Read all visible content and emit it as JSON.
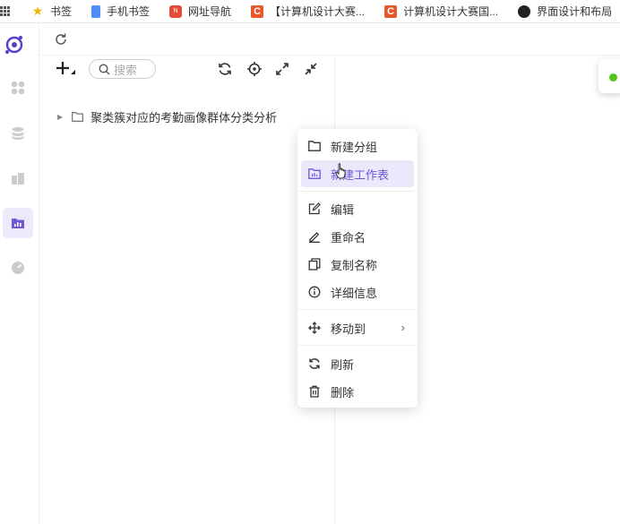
{
  "bookmarks": [
    {
      "label": "书签",
      "icon": "star-icon"
    },
    {
      "label": "手机书签",
      "icon": "phone-bookmark-icon"
    },
    {
      "label": "网址导航",
      "icon": "nav-icon"
    },
    {
      "label": "【计算机设计大赛...",
      "icon": "c-site-icon"
    },
    {
      "label": "计算机设计大赛国...",
      "icon": "c-site-icon"
    },
    {
      "label": "界面设计和布局",
      "icon": "dark-site-icon"
    }
  ],
  "tree": {
    "search_placeholder": "搜索",
    "root_label": "聚类簇对应的考勤画像群体分类分析"
  },
  "menu": {
    "new_group": "新建分组",
    "new_sheet": "新建工作表",
    "edit": "编辑",
    "rename": "重命名",
    "copy_name": "复制名称",
    "details": "详细信息",
    "move_to": "移动到",
    "refresh": "刷新",
    "delete": "删除"
  },
  "colors": {
    "accent": "#6f57d8",
    "highlight_bg": "#ece8fb",
    "status_dot": "#52c41a"
  }
}
